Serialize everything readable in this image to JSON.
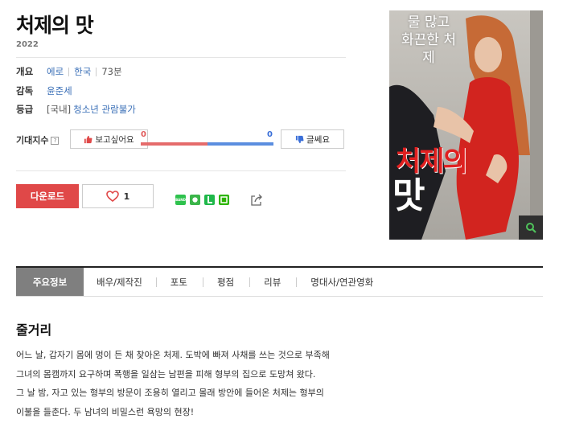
{
  "movie": {
    "title": "처제의 맛",
    "year": "2022",
    "genre_label": "개요",
    "genre": "에로",
    "country": "한국",
    "runtime": "73분",
    "director_label": "감독",
    "director": "윤준세",
    "rating_label": "등급",
    "rating_region": "[국내]",
    "rating": "청소년 관람불가"
  },
  "expect": {
    "label": "기대지수",
    "help": "?",
    "want_label": "보고싶어요",
    "want_count": "0",
    "meh_label": "글쎄요",
    "meh_count": "0",
    "want_ratio": 0.5
  },
  "actions": {
    "download_label": "다운로드",
    "like_count": "1"
  },
  "share": {
    "icons": [
      "band-icon",
      "kakaostory-icon",
      "line-icon",
      "naver-icon"
    ],
    "band_text": "BAND"
  },
  "poster": {
    "tagline": "물 많고 화끈한 처제",
    "title_line1": "처제의",
    "title_line2": "맛"
  },
  "tabs": [
    {
      "label": "주요정보"
    },
    {
      "label": "배우/제작진"
    },
    {
      "label": "포토"
    },
    {
      "label": "평점"
    },
    {
      "label": "리뷰"
    },
    {
      "label": "명대사/연관영화"
    }
  ],
  "synopsis": {
    "heading": "줄거리",
    "lines": [
      "어느 날, 갑자기 몸에 멍이 든 채 찾아온 처제. 도박에 빠져 사채를 쓰는 것으로 부족해",
      "그녀의 몸캠까지 요구하며 폭행을 일삼는 남편을 피해 형부의 집으로 도망쳐 왔다.",
      "그 날 밤, 자고 있는 형부의 방문이 조용히 열리고 몰래 방안에 들어온 처제는 형부의",
      "이불을 들춘다. 두 남녀의 비밀스런 욕망의 현장!"
    ]
  },
  "colors": {
    "accent_red": "#e04848",
    "link_blue": "#3a6fb7",
    "tab_active": "#7f7f7f"
  }
}
